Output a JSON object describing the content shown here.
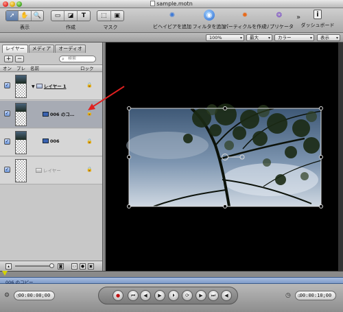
{
  "window": {
    "title": "sample.motn"
  },
  "toolbar": {
    "groups": [
      {
        "label": "表示",
        "tools": [
          "pointer",
          "hand",
          "zoom"
        ]
      },
      {
        "label": "作成",
        "tools": [
          "rectangle",
          "bezier",
          "text"
        ]
      },
      {
        "label": "マスク",
        "tools": [
          "rect-mask",
          "freehand-mask"
        ]
      }
    ],
    "buttons": [
      {
        "label": "ビヘイビアを追加",
        "icon": "gear-burst-icon",
        "color": "#3a78d8"
      },
      {
        "label": "フィルタを追加",
        "icon": "filter-icon",
        "color": "#2a6ad0"
      },
      {
        "label": "パーティクルを作成",
        "icon": "particles-icon",
        "color": "#e86a1a"
      },
      {
        "label": "リプリケータ",
        "icon": "replicator-icon",
        "color": "#7a4ac8"
      },
      {
        "label": "ダッシュボード",
        "icon": "info-icon",
        "color": "#222222"
      }
    ]
  },
  "options": {
    "zoom": "100%",
    "resolution": "最大",
    "channel": "カラー",
    "view": "表示"
  },
  "layers_panel": {
    "tabs": [
      "レイヤー",
      "メディア",
      "オーディオ"
    ],
    "active_tab": "レイヤー",
    "add_label": "+",
    "remove_label": "−",
    "search_placeholder": "検索",
    "columns": {
      "on": "オン",
      "preview": "プレ",
      "name": "名前",
      "lock": "ロック"
    },
    "rows": [
      {
        "name": "レイヤー 1",
        "kind": "group",
        "enabled": true,
        "selected": false
      },
      {
        "name": "006 のコ…",
        "kind": "layer",
        "enabled": true,
        "selected": true
      },
      {
        "name": "006",
        "kind": "layer",
        "enabled": true,
        "selected": false
      },
      {
        "name": "レイヤー",
        "kind": "empty",
        "enabled": true,
        "selected": false
      }
    ]
  },
  "timeline": {
    "track_label": "006 のコピー",
    "current_time": "00:00:00;00",
    "end_time": "00:00:10;00"
  },
  "colors": {
    "selection_row": "#a7abb4",
    "arrow": "#e02020",
    "track": "#8ea8d4"
  }
}
